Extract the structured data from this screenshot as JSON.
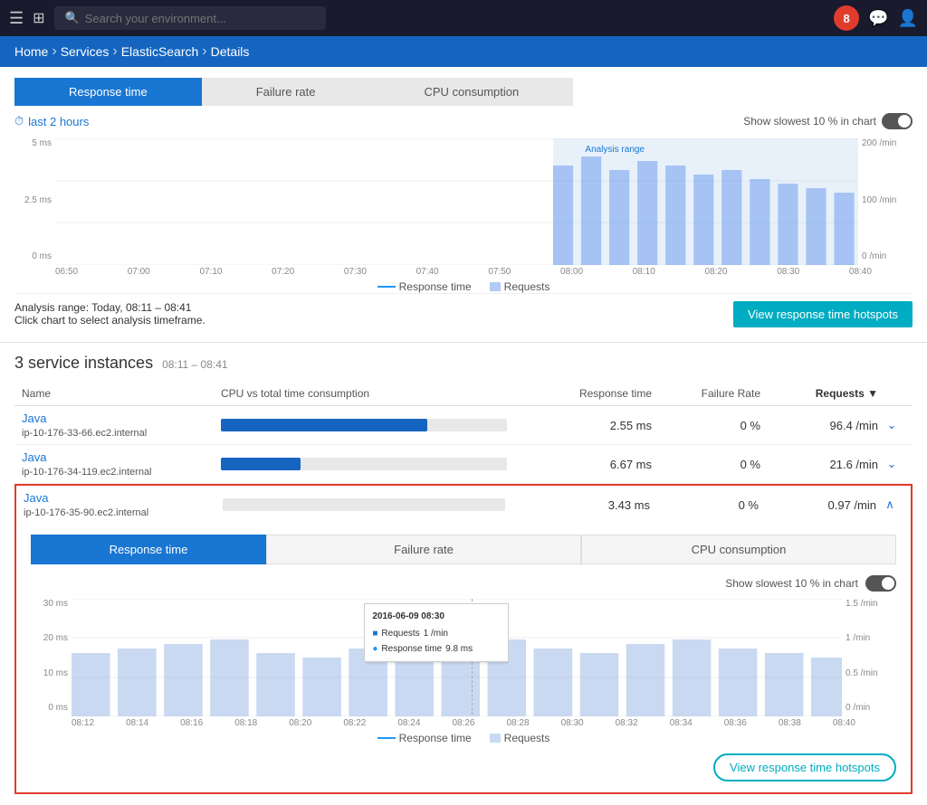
{
  "topbar": {
    "search_placeholder": "Search your environment...",
    "badge_count": "8"
  },
  "breadcrumb": {
    "home": "Home",
    "services": "Services",
    "elasticsearch": "ElasticSearch",
    "details": "Details"
  },
  "chart_section": {
    "tabs": [
      {
        "label": "Response time",
        "active": true
      },
      {
        "label": "Failure rate",
        "active": false
      },
      {
        "label": "CPU consumption",
        "active": false
      }
    ],
    "time_link": "last 2 hours",
    "show_slowest_label": "Show slowest 10 % in chart",
    "analysis_range": "Analysis range: Today, 08:11 – 08:41",
    "click_hint": "Click chart to select analysis timeframe.",
    "view_hotspots_btn": "View response time hotspots",
    "x_labels": [
      "06:50",
      "07:00",
      "07:10",
      "07:20",
      "07:30",
      "07:40",
      "07:50",
      "08:00",
      "08:10",
      "08:20",
      "08:30",
      "08:40"
    ],
    "y_left_labels": [
      "5 ms",
      "2.5 ms",
      "0 ms"
    ],
    "y_right_labels": [
      "200 /min",
      "100 /min",
      "0 /min"
    ],
    "analysis_range_label": "Analysis range"
  },
  "instances_section": {
    "title": "3 service instances",
    "time_range": "08:11 – 08:41",
    "columns": {
      "name": "Name",
      "cpu": "CPU vs total time consumption",
      "response_time": "Response time",
      "failure_rate": "Failure Rate",
      "requests": "Requests"
    },
    "rows": [
      {
        "name": "Java",
        "host": "ip-10-176-33-66.ec2.internal",
        "cpu_pct": 72,
        "cpu_dark_pct": 65,
        "response_time": "2.55 ms",
        "failure_rate": "0 %",
        "requests": "96.4 /min",
        "expanded": false
      },
      {
        "name": "Java",
        "host": "ip-10-176-34-119.ec2.internal",
        "cpu_pct": 28,
        "cpu_dark_pct": 20,
        "response_time": "6.67 ms",
        "failure_rate": "0 %",
        "requests": "21.6 /min",
        "expanded": false
      },
      {
        "name": "Java",
        "host": "ip-10-176-35-90.ec2.internal",
        "cpu_pct": 0,
        "cpu_dark_pct": 0,
        "response_time": "3.43 ms",
        "failure_rate": "0 %",
        "requests": "0.97 /min",
        "expanded": true
      }
    ]
  },
  "detail_panel": {
    "tabs": [
      {
        "label": "Response time",
        "active": true
      },
      {
        "label": "Failure rate",
        "active": false
      },
      {
        "label": "CPU consumption",
        "active": false
      }
    ],
    "show_slowest_label": "Show slowest 10 % in chart",
    "tooltip": {
      "date": "2016-06-09 08:30",
      "requests_label": "Requests",
      "requests_value": "1 /min",
      "response_label": "Response time",
      "response_value": "9.8 ms"
    },
    "x_labels": [
      "08:12",
      "08:14",
      "08:16",
      "08:18",
      "08:20",
      "08:22",
      "08:24",
      "08:26",
      "08:28",
      "08:30",
      "08:32",
      "08:34",
      "08:36",
      "08:38",
      "08:40"
    ],
    "y_left_labels": [
      "30 ms",
      "20 ms",
      "10 ms",
      "0 ms"
    ],
    "y_right_labels": [
      "1.5 /min",
      "1 /min",
      "0.5 /min",
      "0 /min"
    ],
    "legend_response": "Response time",
    "legend_requests": "Requests",
    "view_hotspots_btn": "View response time hotspots"
  },
  "legend": {
    "response_time": "Response time",
    "requests": "Requests"
  }
}
